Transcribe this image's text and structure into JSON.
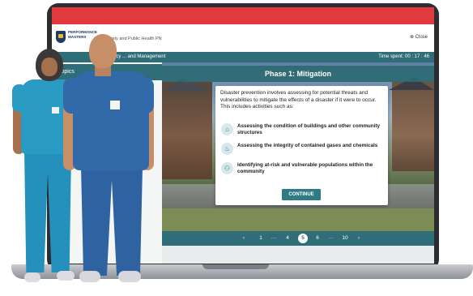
{
  "app": {
    "logo_text": "PERFORMANCE MASTERS",
    "course_title": "Community and Public Health PN",
    "close_label": "Close",
    "nav_label": "Emergency ... and Management",
    "sidebar_title": "Topics",
    "timer": "Time spent: 00 : 17 : 46"
  },
  "lesson": {
    "phase_title": "Phase 1: Mitigation",
    "intro": "Disaster prevention involves assessing for potential threats and vulnerabilities to mitigate the effects of a disaster if it were to occur. This includes activities such as:",
    "bullets": [
      {
        "icon": "building-inspection-icon",
        "text": "Assessing the condition of buildings and other community structures"
      },
      {
        "icon": "flame-icon",
        "text": "Assessing the integrity of contained gases and chemicals"
      },
      {
        "icon": "people-group-icon",
        "text": "Identifying at-risk and vulnerable populations within the community"
      }
    ],
    "continue_label": "CONTINUE"
  },
  "pager": {
    "prev": "‹",
    "items": [
      "1",
      "···",
      "4",
      "5",
      "6",
      "···",
      "10"
    ],
    "current": "5",
    "next": "›"
  },
  "colors": {
    "red_bar": "#e03a3e",
    "teal": "#2f6e78",
    "button": "#2f7b86"
  }
}
